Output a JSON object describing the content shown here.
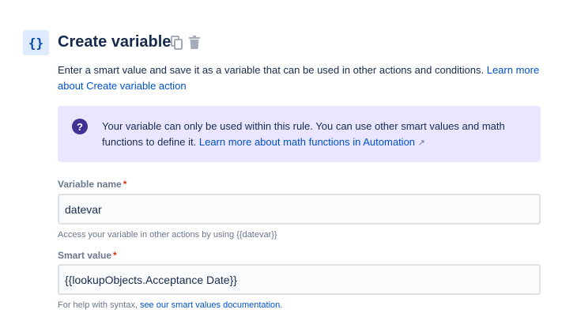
{
  "header": {
    "icon": "{}",
    "title": "Create variable",
    "copy_icon": "copy-icon",
    "delete_icon": "trash-icon"
  },
  "description": {
    "text": "Enter a smart value and save it as a variable that can be used in other actions and conditions. ",
    "link": "Learn more about Create variable action"
  },
  "info_panel": {
    "text": "Your variable can only be used within this rule. You can use other smart values and math functions to define it. ",
    "link": "Learn more about math functions in Automation",
    "link_icon": "↗"
  },
  "fields": [
    {
      "label": "Variable name",
      "required": "*",
      "value": "datevar",
      "help": "Access your variable in other actions by using {{datevar}}"
    },
    {
      "label": "Smart value",
      "required": "*",
      "value": "{{lookupObjects.Acceptance Date}}",
      "help": "For help with syntax, ",
      "help_link": "see our smart values documentation."
    }
  ]
}
